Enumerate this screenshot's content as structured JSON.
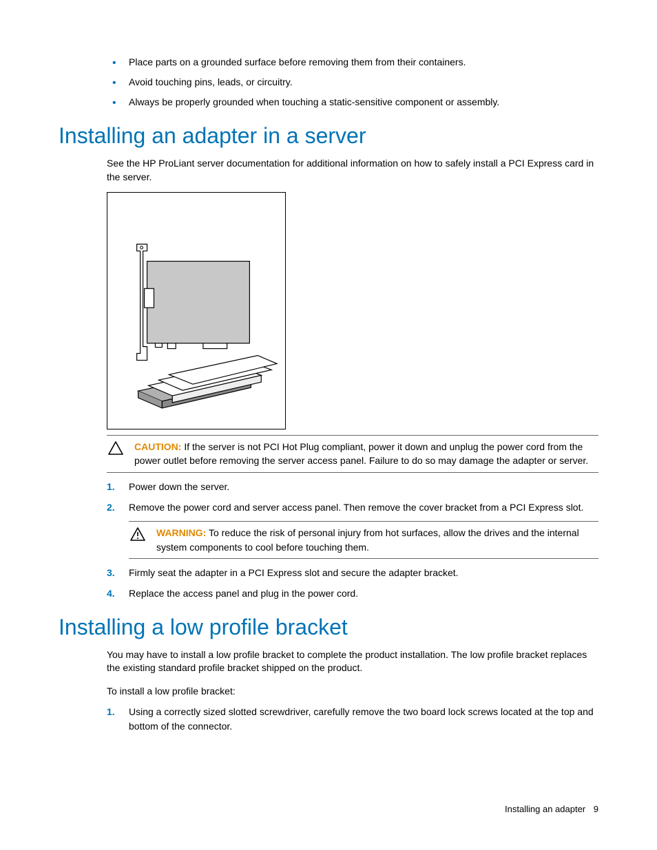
{
  "pre_bullets": [
    "Place parts on a grounded surface before removing them from their containers.",
    "Avoid touching pins, leads, or circuitry.",
    "Always be properly grounded when touching a static-sensitive component or assembly."
  ],
  "section1": {
    "heading": "Installing an adapter in a server",
    "intro": "See the HP ProLiant server documentation for additional information on how to safely install a PCI Express card in the server.",
    "caution_label": "CAUTION:",
    "caution_text": " If the server is not PCI Hot Plug compliant, power it down and unplug the power cord from the power outlet before removing the server access panel. Failure to do so may damage the adapter or server.",
    "steps": [
      "Power down the server.",
      "Remove the power cord and server access panel. Then remove the cover bracket from a PCI Express slot.",
      "Firmly seat the adapter in a PCI Express slot and secure the adapter bracket.",
      "Replace the access panel and plug in the power cord."
    ],
    "warning_label": "WARNING:",
    "warning_text": " To reduce the risk of personal injury from hot surfaces, allow the drives and the internal system components to cool before touching them."
  },
  "section2": {
    "heading": "Installing a low profile bracket",
    "para1": "You may have to install a low profile bracket to complete the product installation. The low profile bracket replaces the existing standard profile bracket shipped on the product.",
    "para2": "To install a low profile bracket:",
    "steps": [
      "Using a correctly sized slotted screwdriver, carefully remove the two board lock screws located at the top and bottom of the connector."
    ]
  },
  "footer": {
    "title": "Installing an adapter",
    "page": "9"
  }
}
